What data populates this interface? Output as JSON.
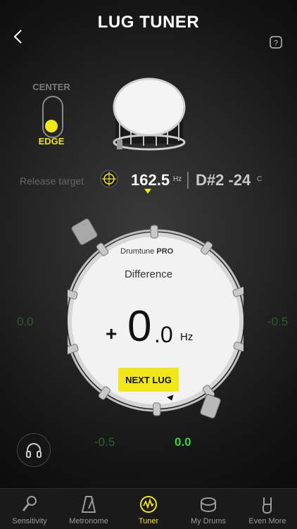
{
  "header": {
    "title": "LUG TUNER"
  },
  "mode_switch": {
    "top_label": "CENTER",
    "bottom_label": "EDGE",
    "selected": "EDGE"
  },
  "tuning": {
    "release_label": "Release target",
    "frequency": "162.5",
    "frequency_unit": "Hz",
    "note": "D#2 -24",
    "cents_unit": "C"
  },
  "drum_display": {
    "brand_prefix": "Drumtune ",
    "brand_bold": "PRO",
    "difference_label": "Difference",
    "sign": "+",
    "value_int": "0",
    "value_frac": ".0",
    "unit": "Hz",
    "next_button": "NEXT LUG"
  },
  "lug_values": {
    "left": "0.0",
    "right": "-0.5",
    "bottom_left": "-0.5",
    "bottom_current": "0.0"
  },
  "colors": {
    "accent": "#f0e61a",
    "green": "#3bd43b",
    "dim_green": "#2a5f2a"
  },
  "tabs": [
    {
      "label": "Sensitivity",
      "icon": "microphone-icon"
    },
    {
      "label": "Metronome",
      "icon": "metronome-icon"
    },
    {
      "label": "Tuner",
      "icon": "tuner-icon",
      "active": true
    },
    {
      "label": "My Drums",
      "icon": "drum-icon"
    },
    {
      "label": "Even More",
      "icon": "rock-hand-icon"
    }
  ]
}
